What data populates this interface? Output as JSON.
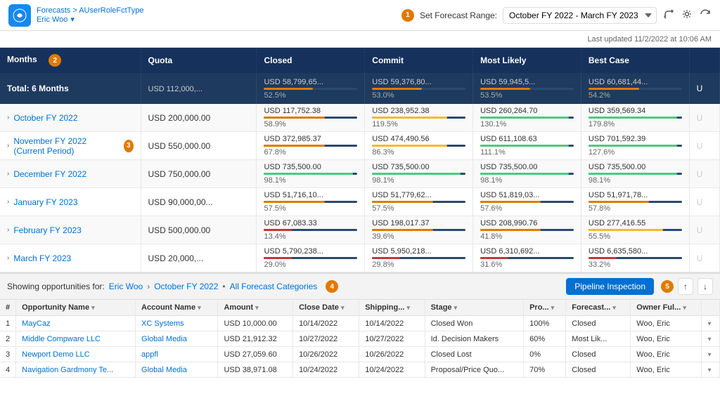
{
  "header": {
    "breadcrumb": "Forecasts > AUserRoleFctType",
    "user": "Eric Woo",
    "forecast_range_label": "Set Forecast Range:",
    "forecast_range_value": "October FY 2022 - March FY 2023",
    "last_updated": "Last updated 11/2/2022 at 10:06 AM",
    "badge1": "1",
    "badge2": "2",
    "badge3": "3",
    "badge4": "4",
    "badge5": "5"
  },
  "table": {
    "columns": [
      "Months",
      "Quota",
      "Closed",
      "Commit",
      "Most Likely",
      "Best Case",
      ""
    ],
    "total_row": {
      "label": "Total: 6 Months",
      "quota": "USD 112,000,...",
      "closed": "USD 58,799,65...",
      "closed_pct": "52.5%",
      "commit": "USD 59,376,80...",
      "commit_pct": "53.0%",
      "most_likely": "USD 59,945,5...",
      "most_likely_pct": "53.5%",
      "best_case": "USD 60,681,44...",
      "best_case_pct": "54.2%",
      "last": "U"
    },
    "rows": [
      {
        "month": "October FY 2022",
        "quota": "USD 200,000.00",
        "closed": "USD 117,752.38",
        "closed_pct": "58.9%",
        "commit": "USD 238,952.38",
        "commit_pct": "119.5%",
        "most_likely": "USD 260,264.70",
        "most_likely_pct": "130.1%",
        "best_case": "USD 359,569.34",
        "best_case_pct": "179.8%",
        "last": "U",
        "bar_closed": "bar-orange",
        "bar_commit": "bar-yellow",
        "bar_ml": "bar-green",
        "bar_bc": "bar-green"
      },
      {
        "month": "November FY 2022 (Current Period)",
        "quota": "USD 550,000.00",
        "closed": "USD 372,985.37",
        "closed_pct": "67.8%",
        "commit": "USD 474,490.56",
        "commit_pct": "86.3%",
        "most_likely": "USD 611,108.63",
        "most_likely_pct": "111.1%",
        "best_case": "USD 701,592.39",
        "best_case_pct": "127.6%",
        "last": "U",
        "bar_closed": "bar-orange",
        "bar_commit": "bar-yellow",
        "bar_ml": "bar-green",
        "bar_bc": "bar-green"
      },
      {
        "month": "December FY 2022",
        "quota": "USD 750,000.00",
        "closed": "USD 735,500.00",
        "closed_pct": "98.1%",
        "commit": "USD 735,500.00",
        "commit_pct": "98.1%",
        "most_likely": "USD 735,500.00",
        "most_likely_pct": "98.1%",
        "best_case": "USD 735,500.00",
        "best_case_pct": "98.1%",
        "last": "U",
        "bar_closed": "bar-green",
        "bar_commit": "bar-green",
        "bar_ml": "bar-green",
        "bar_bc": "bar-green"
      },
      {
        "month": "January FY 2023",
        "quota": "USD 90,000,00...",
        "closed": "USD 51,716,10...",
        "closed_pct": "57.5%",
        "commit": "USD 51,779,62...",
        "commit_pct": "57.5%",
        "most_likely": "USD 51,819,03...",
        "most_likely_pct": "57.6%",
        "best_case": "USD 51,971,78...",
        "best_case_pct": "57.8%",
        "last": "U",
        "bar_closed": "bar-orange",
        "bar_commit": "bar-orange",
        "bar_ml": "bar-orange",
        "bar_bc": "bar-orange"
      },
      {
        "month": "February FY 2023",
        "quota": "USD 500,000.00",
        "closed": "USD 67,083.33",
        "closed_pct": "13.4%",
        "commit": "USD 198,017.37",
        "commit_pct": "39.6%",
        "most_likely": "USD 208,990.76",
        "most_likely_pct": "41.8%",
        "best_case": "USD 277,416.55",
        "best_case_pct": "55.5%",
        "last": "U",
        "bar_closed": "bar-red",
        "bar_commit": "bar-orange",
        "bar_ml": "bar-orange",
        "bar_bc": "bar-yellow"
      },
      {
        "month": "March FY 2023",
        "quota": "USD 20,000,...",
        "closed": "USD 5,790,238...",
        "closed_pct": "29.0%",
        "commit": "USD 5,950,218...",
        "commit_pct": "29.8%",
        "most_likely": "USD 6,310,692...",
        "most_likely_pct": "31.6%",
        "best_case": "USD 6,635,580...",
        "best_case_pct": "33.2%",
        "last": "U",
        "bar_closed": "bar-red",
        "bar_commit": "bar-red",
        "bar_ml": "bar-red",
        "bar_bc": "bar-red"
      }
    ]
  },
  "bottom": {
    "showing_label": "Showing opportunities for:",
    "user": "Eric Woo",
    "period": "October FY 2022",
    "categories": "All Forecast Categories",
    "pipeline_btn": "Pipeline Inspection",
    "opp_columns": [
      "Opportunity Name",
      "Account Name",
      "Amount",
      "Close Date",
      "Shipping...",
      "Stage",
      "Pro...",
      "Forecast...",
      "Owner Ful..."
    ],
    "opportunities": [
      {
        "num": "1",
        "name": "MayCaz",
        "account": "XC Systems",
        "amount": "USD 10,000.00",
        "close_date": "10/14/2022",
        "shipping": "10/14/2022",
        "stage": "Closed Won",
        "prob": "100%",
        "forecast": "Closed",
        "owner": "Woo, Eric"
      },
      {
        "num": "2",
        "name": "Middle Compware LLC",
        "account": "Global Media",
        "amount": "USD 21,912.32",
        "close_date": "10/27/2022",
        "shipping": "10/27/2022",
        "stage": "Id. Decision Makers",
        "prob": "60%",
        "forecast": "Most Lik...",
        "owner": "Woo, Eric"
      },
      {
        "num": "3",
        "name": "Newport Demo LLC",
        "account": "appfl",
        "amount": "USD 27,059.60",
        "close_date": "10/26/2022",
        "shipping": "10/26/2022",
        "stage": "Closed Lost",
        "prob": "0%",
        "forecast": "Closed",
        "owner": "Woo, Eric"
      },
      {
        "num": "4",
        "name": "Navigation Gardmony Te...",
        "account": "Global Media",
        "amount": "USD 38,971.08",
        "close_date": "10/24/2022",
        "shipping": "10/24/2022",
        "stage": "Proposal/Price Quo...",
        "prob": "70%",
        "forecast": "Closed",
        "owner": "Woo, Eric"
      }
    ]
  }
}
